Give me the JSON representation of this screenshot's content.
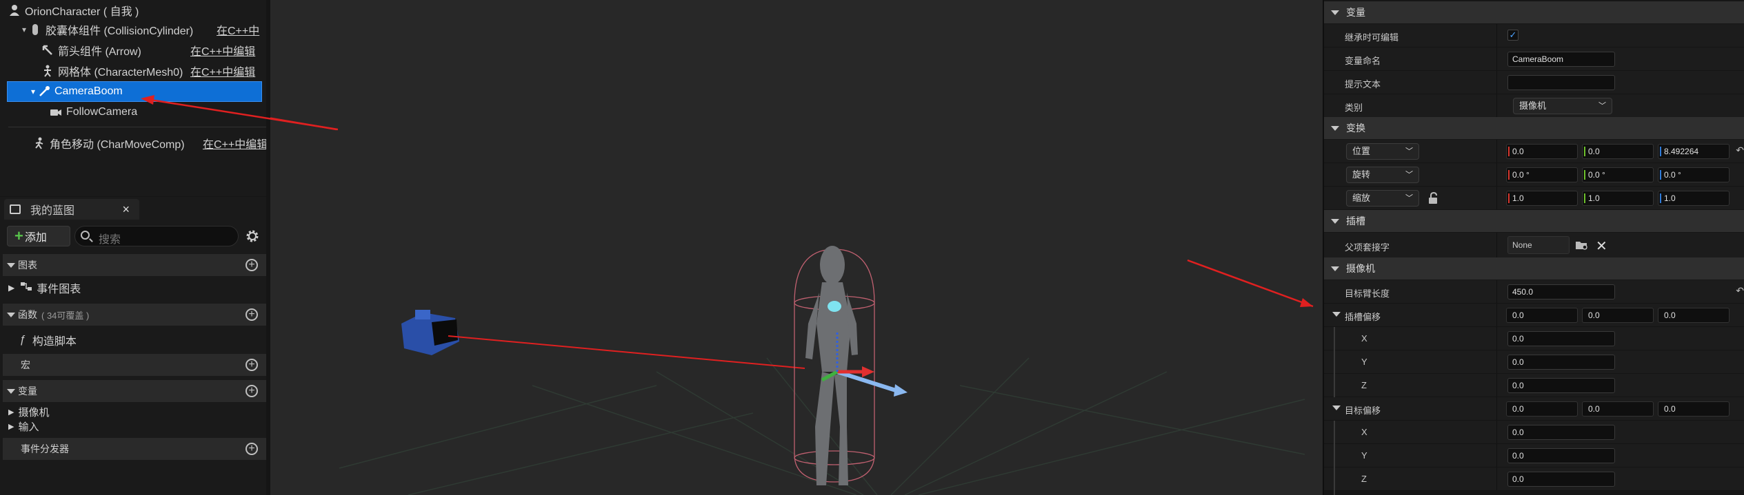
{
  "components": {
    "root": "OrionCharacter  ( 自我 )",
    "capsule": "胶囊体组件 (CollisionCylinder)",
    "capsule_edit": "在C++中",
    "arrow": "箭头组件 (Arrow)",
    "arrow_edit": "在C++中编辑",
    "mesh": "网格体 (CharacterMesh0)",
    "mesh_edit": "在C++中编辑",
    "boom": "CameraBoom",
    "camera": "FollowCamera",
    "move": "角色移动 (CharMoveComp)",
    "move_edit": "在C++中编辑"
  },
  "blueprint": {
    "tab": "我的蓝图",
    "close": "×",
    "add": "添加",
    "search_placeholder": "搜索",
    "graphs": "图表",
    "event_graph": "事件图表",
    "functions": "函数",
    "functions_note": "( 34可覆盖 )",
    "construct": "构造脚本",
    "macros": "宏",
    "variables": "变量",
    "var_camera": "摄像机",
    "var_input": "输入",
    "dispatchers": "事件分发器"
  },
  "details": {
    "var_section": "变量",
    "editable": "继承时可编辑",
    "var_name": "变量命名",
    "var_name_value": "CameraBoom",
    "tooltip": "提示文本",
    "category": "类别",
    "category_value": "摄像机",
    "transform_section": "变换",
    "location": "位置",
    "rotation": "旋转",
    "scale": "缩放",
    "loc": [
      "0.0",
      "0.0",
      "8.492264"
    ],
    "rot": [
      "0.0 °",
      "0.0 °",
      "0.0 °"
    ],
    "scl": [
      "1.0",
      "1.0",
      "1.0"
    ],
    "socket_section": "插槽",
    "parent_socket": "父项套接字",
    "parent_socket_value": "None",
    "camera_section": "摄像机",
    "arm_length": "目标臂长度",
    "arm_length_value": "450.0",
    "socket_offset": "插槽偏移",
    "socket_offset_vals": [
      "0.0",
      "0.0",
      "0.0"
    ],
    "so_x": "X",
    "so_y": "Y",
    "so_z": "Z",
    "so_vals": [
      "0.0",
      "0.0",
      "0.0"
    ],
    "target_offset": "目标偏移",
    "target_offset_vals": [
      "0.0",
      "0.0",
      "0.0"
    ],
    "to_vals": [
      "0.0",
      "0.0",
      "0.0"
    ]
  },
  "colors": {
    "selection": "#0e6fd6",
    "accent_arrow": "#e02020",
    "x_axis": "#d6352c",
    "y_axis": "#6cbf2b",
    "z_axis": "#2f7bd8"
  }
}
